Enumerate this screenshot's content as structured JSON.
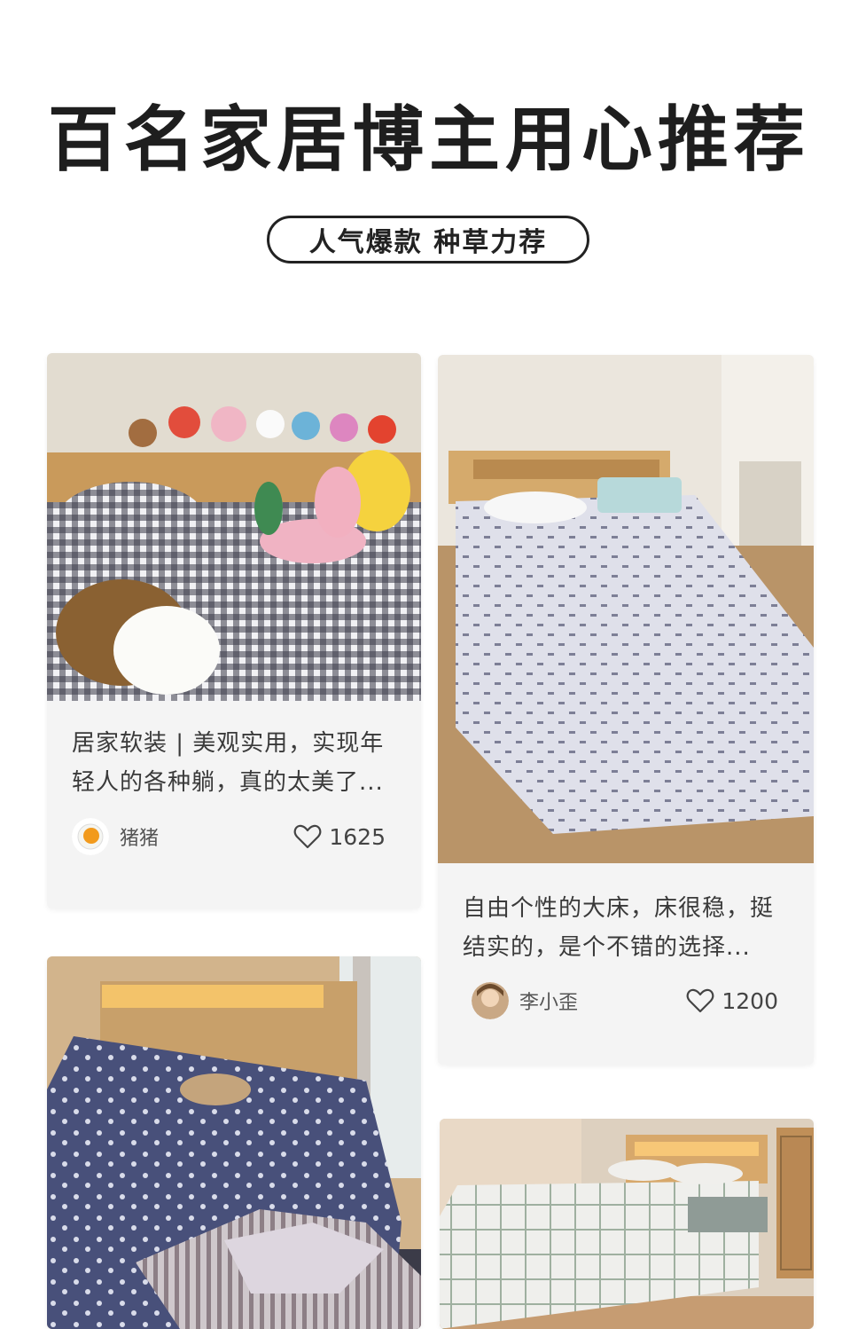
{
  "header": {
    "headline": "百名家居博主用心推荐",
    "tagline": "人气爆款 种草力荐"
  },
  "posts": [
    {
      "title": "居家软装 | 美观实用，实现年轻人的各种躺，真的太美了...",
      "author": "猪猪",
      "likes": "1625",
      "image": "bed-with-plush-toys-gingham-sheets"
    },
    {
      "title": "自由个性的大床，床很稳，挺结实的，是个不错的选择...",
      "author": "李小歪",
      "likes": "1200",
      "image": "wooden-bed-white-dotted-sheet"
    },
    {
      "image": "wooden-bed-led-headboard-navy-floral-sheet"
    },
    {
      "image": "wooden-bed-led-headboard-check-bedding"
    }
  ],
  "icons": {
    "like": "heart-outline-icon"
  },
  "colors": {
    "headline": "#1e1e1e",
    "card_bg": "#f4f4f4",
    "text": "#3a3a3a"
  }
}
